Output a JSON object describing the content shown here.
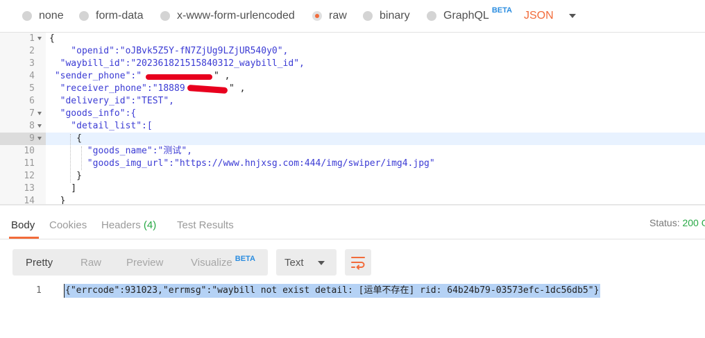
{
  "body_types": [
    {
      "label": "none",
      "selected": false
    },
    {
      "label": "form-data",
      "selected": false
    },
    {
      "label": "x-www-form-urlencoded",
      "selected": false
    },
    {
      "label": "raw",
      "selected": true
    },
    {
      "label": "binary",
      "selected": false
    },
    {
      "label": "GraphQL",
      "selected": false,
      "badge": "BETA"
    }
  ],
  "raw_language": "JSON",
  "editor": {
    "line_numbers": [
      "1",
      "2",
      "3",
      "4",
      "5",
      "6",
      "7",
      "8",
      "9",
      "10",
      "11",
      "12",
      "13",
      "14"
    ],
    "lines": [
      "{",
      "    \"openid\":\"oJBvk5Z5Y-fN7ZjUg9LZjUR540y0\",",
      "  \"waybill_id\":\"202361821515840312_waybill_id\",",
      " \"sender_phone\":\"",
      "  \"receiver_phone\":\"18889",
      "  \"delivery_id\":\"TEST\",",
      "  \"goods_info\":{",
      "    \"detail_list\":[",
      "     {",
      "       \"goods_name\":\"测试\",",
      "       \"goods_img_url\":\"https://www.hnjxsg.com:444/img/swiper/img4.jpg\"",
      "     }",
      "    ]",
      "  }"
    ],
    "line_tails": {
      "sender_phone": "\" ,",
      "receiver_phone": "\" ,"
    },
    "active_line": 9
  },
  "response": {
    "tabs": [
      {
        "label": "Body",
        "active": true
      },
      {
        "label": "Cookies",
        "active": false
      },
      {
        "label": "Headers",
        "count": "(4)",
        "active": false
      },
      {
        "label": "Test Results",
        "active": false
      }
    ],
    "status_label": "Status:",
    "status_value": "200 O",
    "view_modes": [
      {
        "label": "Pretty",
        "active": true
      },
      {
        "label": "Raw",
        "active": false
      },
      {
        "label": "Preview",
        "active": false
      },
      {
        "label": "Visualize",
        "active": false,
        "badge": "BETA"
      }
    ],
    "format": "Text",
    "body_line_number": "1",
    "body_text": "{\"errcode\":931023,\"errmsg\":\"waybill not exist detail: [运单不存在] rid: 64b24b79-03573efc-1dc56db5\"}"
  },
  "colors": {
    "accent": "#f26b3a",
    "beta": "#2b8de0",
    "status_ok": "#27a844",
    "json_string": "#3b3bd4",
    "selection": "#b5d2f5",
    "redaction": "#e8001e"
  }
}
